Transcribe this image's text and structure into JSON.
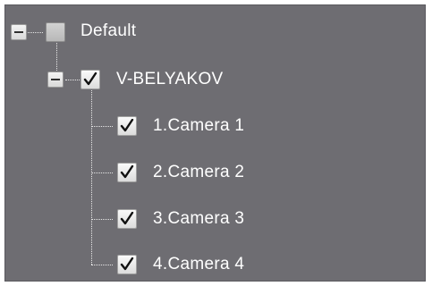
{
  "tree": {
    "root": {
      "label": "Default",
      "expanded": true,
      "checked": false,
      "expander_icon": "minus-icon"
    },
    "server": {
      "label": "V-BELYAKOV",
      "expanded": true,
      "checked": true,
      "expander_icon": "minus-icon"
    },
    "cameras": [
      {
        "label": "1.Camera 1",
        "checked": true
      },
      {
        "label": "2.Camera 2",
        "checked": true
      },
      {
        "label": "3.Camera 3",
        "checked": true
      },
      {
        "label": "4.Camera 4",
        "checked": true
      }
    ]
  },
  "colors": {
    "panel_background": "#6e6d72",
    "text": "#ffffff",
    "connector": "#e8e8e8"
  }
}
